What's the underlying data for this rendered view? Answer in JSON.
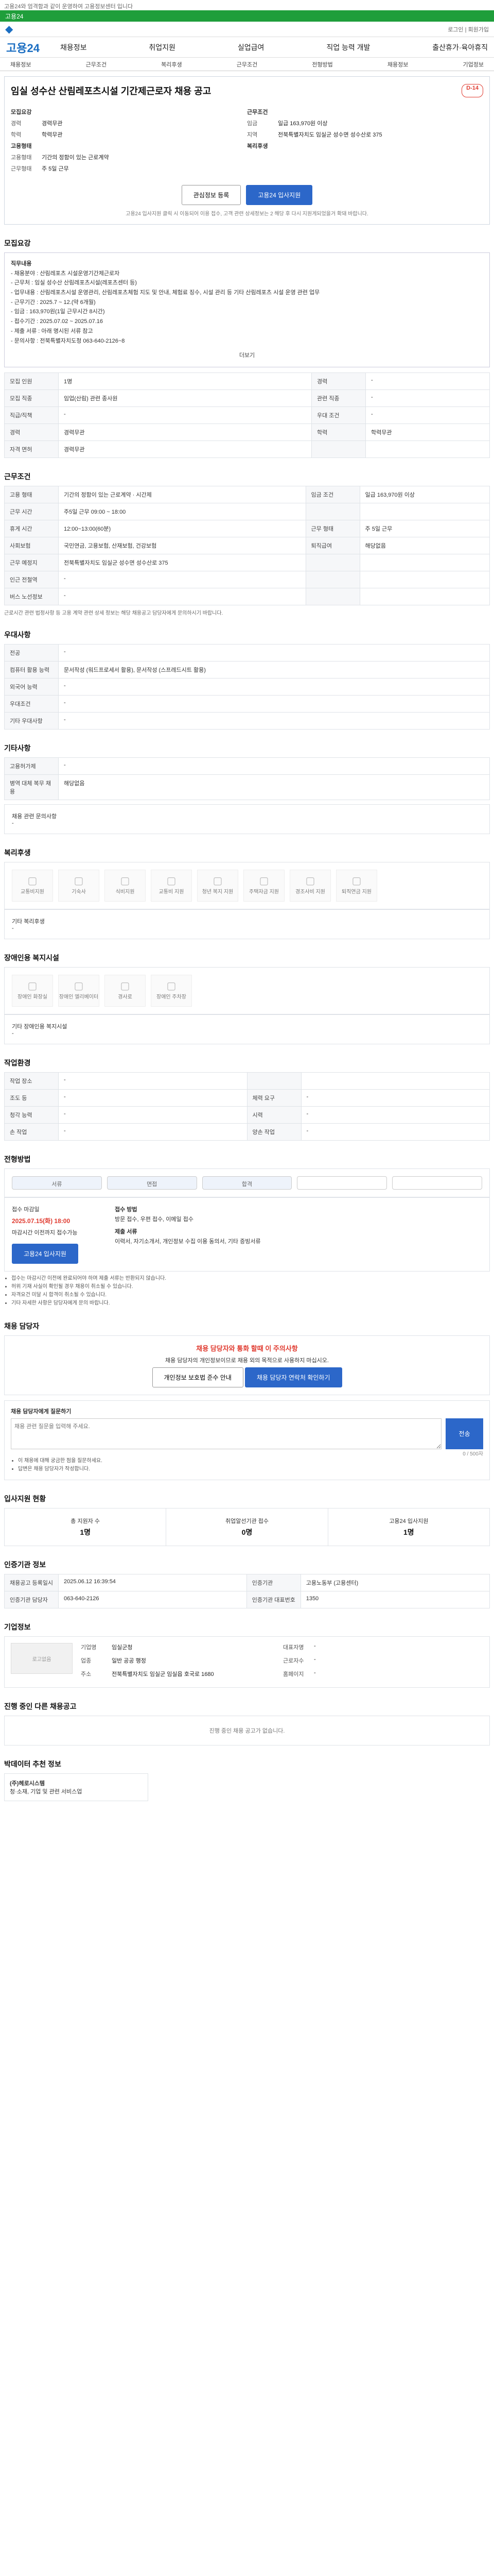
{
  "top_note": "고용24와 엄격함과 같이 운영하여 고용정보센터 입니다",
  "green_bar": "고용24",
  "brand": "고용24",
  "gnb_right": "로그인 | 회원가입",
  "menu": [
    "채용정보",
    "취업지원",
    "실업급여",
    "직업 능력 개발",
    "출산휴가·육아휴직"
  ],
  "subnav": [
    "채용정보",
    "근무조건",
    "복리후생",
    "근무조건",
    "전형방법",
    "채용정보",
    "기업정보"
  ],
  "title": "임실 성수산 산림레포츠시설 기간제근로자 채용 공고",
  "dday": "D-14",
  "header": {
    "left_label": "모집요강",
    "left": [
      {
        "k": "경력",
        "v": "경력무관"
      },
      {
        "k": "학력",
        "v": "학력무관"
      }
    ],
    "right_label": "근무조건",
    "right": [
      {
        "k": "임금",
        "v": "일급 163,970원 이상"
      },
      {
        "k": "지역",
        "v": "전북특별자치도 임실군 성수면 성수산로 375"
      }
    ],
    "left2_label": "고용형태",
    "left2": [
      {
        "k": "고용형태",
        "v": "기간의 정함이 있는 근로계약"
      },
      {
        "k": "근무형태",
        "v": "주 5일 근무"
      }
    ],
    "right2_label": "복리후생",
    "right2": []
  },
  "buttons": {
    "scrap": "관심정보 등록",
    "apply": "고용24 입사지원"
  },
  "header_note": "고용24 입사지원 클릭 시 이동되어 이용 접수, 고객 관련 상세정보는 2 해당 후 다시 지원게되었을거 확돼 바랍니다.",
  "recruit": {
    "title": "모집요강",
    "body_title": "직무내용",
    "body": [
      "- 채용분야 : 산림레포츠 시설운영기간제근로자",
      "- 근무처 : 임실 성수산 산림레포츠시설(레포츠센터 등)",
      "- 업무내용 : 산림레포츠시설 운영관리, 산림레포츠체험 지도 및 안내, 체험료 징수, 시설 관리 등 기타 산림레포츠 시설 운영 관련 업무",
      "- 근무기간 : 2025.7 ~ 12.(약 6개월)",
      "- 임금 : 163,970원(1일 근무시간 8시간)",
      "- 접수기간 : 2025.07.02 ~ 2025.07.16",
      "- 제출 서류 : 아래 명시된 서류 참고",
      "- 문의사항 : 전북특별자치도청 063-640-2126~8"
    ],
    "more": "더보기",
    "rows": [
      {
        "k": "모집 인원",
        "v": "1명",
        "k2": "경력",
        "v2": "-"
      },
      {
        "k": "모집 직종",
        "v": "임업(산림) 관련 종사원",
        "k2": "관련 직종",
        "v2": "-"
      },
      {
        "k": "직급/직책",
        "v": "-",
        "k2": "우대 조건",
        "v2": "-"
      },
      {
        "k": "경력",
        "v": "경력무관",
        "k2": "학력",
        "v2": "학력무관"
      },
      {
        "k": "자격 면허",
        "v": "경력무관",
        "k2": "",
        "v2": ""
      }
    ]
  },
  "work": {
    "title": "근무조건",
    "rows": [
      {
        "k": "고용 형태",
        "v": "기간의 정함이 있는 근로계약 · 시간제",
        "k2": "임금 조건",
        "v2": "일급 163,970원 이상"
      },
      {
        "k": "근무 시간",
        "v": "주5일 근무 09:00 ~ 18:00",
        "k2": "",
        "v2": ""
      },
      {
        "k": "휴게 시간",
        "v": "12:00~13:00(60분)",
        "k2": "근무 형태",
        "v2": "주 5일 근무"
      },
      {
        "k": "사회보험",
        "v": "국민연금, 고용보험, 산재보험, 건강보험",
        "k2": "퇴직급여",
        "v2": "해당없음"
      },
      {
        "k": "근무 예정지",
        "v": "전북특별자치도 임실군 성수면 성수산로 375",
        "k2": "",
        "v2": ""
      },
      {
        "k": "인근 전철역",
        "v": "-",
        "k2": "",
        "v2": ""
      },
      {
        "k": "버스 노선정보",
        "v": "-",
        "k2": "",
        "v2": ""
      }
    ],
    "note": "근로시간 관련 법정사항 등 고용 계약 관련 상세 정보는 해당 채용공고 담당자에게 문의하시기 바랍니다."
  },
  "pref": {
    "title": "우대사항",
    "rows": [
      {
        "k": "전공",
        "v": "-"
      },
      {
        "k": "컴퓨터 활용 능력",
        "v": "문서작성 (워드프로세서 활용), 문서작성 (스프레드시트 활용)"
      },
      {
        "k": "외국어 능력",
        "v": "-"
      },
      {
        "k": "우대조건",
        "v": "-"
      },
      {
        "k": "기타 우대사항",
        "v": "-"
      }
    ]
  },
  "other": {
    "title": "기타사항",
    "rows": [
      {
        "k": "고용허가제",
        "v": "-"
      },
      {
        "k": "병역 대체 복무 채용",
        "v": "해당없음"
      }
    ],
    "note": "채용 관련 문의사항",
    "note_value": "-"
  },
  "welfare": {
    "title": "복리후생",
    "items": [
      "교통비지원",
      "기숙사",
      "식비지원",
      "교통비 지원",
      "청년 복지 지원",
      "주택자금 지원",
      "경조사비 지원",
      "퇴직연금 지원"
    ],
    "etc_label": "기타 복리후생",
    "etc_value": "-"
  },
  "disability": {
    "title": "장애인용 복지시설",
    "items": [
      "장애인 화장실",
      "장애인 엘리베이터",
      "경사로",
      "장애인 주차장"
    ],
    "etc_label": "기타 장애인용 복지시설",
    "etc_value": "-"
  },
  "workenv": {
    "title": "작업환경",
    "rows": [
      {
        "k": "작업 장소",
        "v": "-",
        "k2": "",
        "v2": ""
      },
      {
        "k": "조도 등",
        "v": "-",
        "k2": "체력 요구",
        "v2": "-"
      },
      {
        "k": "청각 능력",
        "v": "-",
        "k2": "시력",
        "v2": "-"
      },
      {
        "k": "손 작업",
        "v": "-",
        "k2": "양손 작업",
        "v2": "-"
      }
    ]
  },
  "selection": {
    "title": "전형방법",
    "steps": [
      "서류",
      "면접",
      "합격",
      "",
      ""
    ],
    "apply_title": "접수 마감일",
    "apply_date": "2025.07.15(화) 18:00",
    "apply_note": "마감시간 이전까지 접수가능",
    "apply_button": "고용24 입사지원",
    "method_label": "접수 방법",
    "method": "방문 접수, 우편 접수, 이메일 접수",
    "docs_label": "제출 서류",
    "docs": "이력서, 자기소개서, 개인정보 수집 이용 동의서, 기타 증빙서류",
    "notes": [
      "접수는 마감시간 이전에 완료되어야 하며 제출 서류는 반환되지 않습니다.",
      "허위 기재 사실이 확인될 경우 채용이 취소될 수 있습니다.",
      "자격요건 미달 시 합격이 취소될 수 있습니다.",
      "기타 자세한 사항은 담당자에게 문의 바랍니다."
    ]
  },
  "contact": {
    "title": "채용 담당자",
    "warn_title": "채용 담당자와 통화 할때 이 주의사항",
    "warn_text": "채용 담당자의 개인정보이므로 채용 외의 목적으로 사용하지 마십시오.",
    "btn1": "개인정보 보호법 준수 안내",
    "btn2": "채용 담당자 연락처 확인하기",
    "qa_title": "채용 담당자에게 질문하기",
    "qa_placeholder": "채용 관련 질문을 입력해 주세요.",
    "qa_send": "전송",
    "qa_count": "0 / 500자",
    "qa_notes": [
      "이 채용에 대해 궁금한 점을 질문하세요.",
      "답변은 채용 담당자가 작성합니다."
    ]
  },
  "stats": {
    "title": "입사지원 현황",
    "items": [
      {
        "k": "총 지원자 수",
        "v": "1명"
      },
      {
        "k": "취업알선기관 접수",
        "v": "0명"
      },
      {
        "k": "고용24 입사지원",
        "v": "1명"
      }
    ]
  },
  "inst": {
    "title": "인증기관 정보",
    "rows": [
      {
        "k": "채용공고 등록일시",
        "v": "2025.06.12 16:39:54",
        "k2": "인증기관",
        "v2": "고용노동부 (고용센터)"
      },
      {
        "k": "인증기관 담당자",
        "v": "063-640-2126",
        "k2": "인증기관 대표번호",
        "v2": "1350"
      }
    ]
  },
  "company": {
    "title": "기업정보",
    "logo": "로고없음",
    "fields": [
      {
        "k": "기업명",
        "v": "임실군청"
      },
      {
        "k": "대표자명",
        "v": "-"
      },
      {
        "k": "업종",
        "v": "일반 공공 행정"
      },
      {
        "k": "근로자수",
        "v": "-"
      },
      {
        "k": "주소",
        "v": "전북특별자치도 임실군 임실읍 호국로 1680"
      },
      {
        "k": "홈페이지",
        "v": "-"
      }
    ]
  },
  "others": {
    "title": "진행 중인 다른 채용공고",
    "empty": "진행 중인 채용 공고가 없습니다.",
    "nearby_title": "박데이터 추천 정보",
    "card_name": "(주)헤로시스템",
    "card_desc": "청·소재, 기업 및 관련 서비스업"
  }
}
